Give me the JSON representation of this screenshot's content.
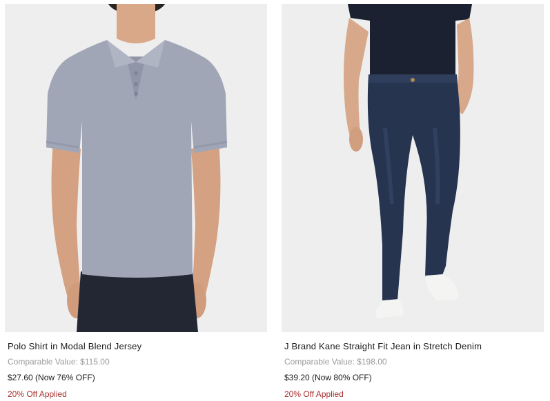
{
  "products": [
    {
      "name": "Polo Shirt in Modal Blend Jersey",
      "comparable_value": "Comparable Value: $115.00",
      "price": "$27.60 (Now 76% OFF)",
      "promo": "20% Off Applied",
      "image": "product-photo-polo-shirt"
    },
    {
      "name": "J Brand Kane Straight Fit Jean in Stretch Denim",
      "comparable_value": "Comparable Value: $198.00",
      "price": "$39.20 (Now 80% OFF)",
      "promo": "20% Off Applied",
      "image": "product-photo-jeans"
    }
  ],
  "colors": {
    "promo": "#a83232",
    "comparable": "#9a9a9a",
    "image_bg": "#eeeeee"
  }
}
